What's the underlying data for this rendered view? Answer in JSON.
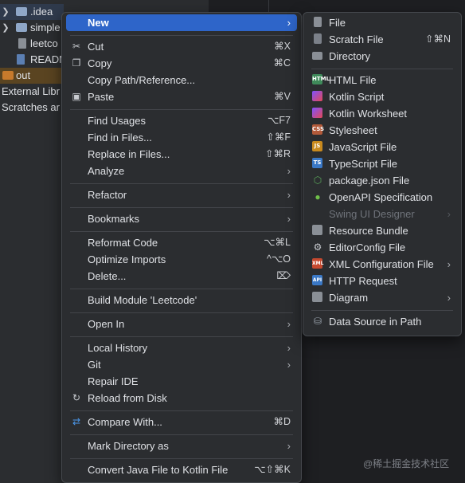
{
  "project_tree": {
    "items": [
      {
        "label": ".idea",
        "icon": "folder-icon"
      },
      {
        "label": "simple",
        "icon": "folder-icon"
      },
      {
        "label": "leetco",
        "icon": "file-icon"
      },
      {
        "label": "READM",
        "icon": "markdown-file-icon"
      },
      {
        "label": "out",
        "icon": "folder-icon"
      },
      {
        "label": "External Libr",
        "icon": ""
      },
      {
        "label": "Scratches ar",
        "icon": ""
      }
    ]
  },
  "context_menu": {
    "items": [
      {
        "label": "New",
        "shortcut": "",
        "arrow": "›",
        "icon": "",
        "highlighted": true
      },
      {
        "label": "Cut",
        "shortcut": "⌘X",
        "icon": "scissors-icon"
      },
      {
        "label": "Copy",
        "shortcut": "⌘C",
        "icon": "copy-icon"
      },
      {
        "label": "Copy Path/Reference...",
        "shortcut": ""
      },
      {
        "label": "Paste",
        "shortcut": "⌘V",
        "icon": "paste-icon"
      },
      {
        "label": "Find Usages",
        "shortcut": "⌥F7"
      },
      {
        "label": "Find in Files...",
        "shortcut": "⇧⌘F"
      },
      {
        "label": "Replace in Files...",
        "shortcut": "⇧⌘R"
      },
      {
        "label": "Analyze",
        "arrow": "›"
      },
      {
        "label": "Refactor",
        "arrow": "›"
      },
      {
        "label": "Bookmarks",
        "arrow": "›"
      },
      {
        "label": "Reformat Code",
        "shortcut": "⌥⌘L"
      },
      {
        "label": "Optimize Imports",
        "shortcut": "^⌥O"
      },
      {
        "label": "Delete...",
        "shortcut": "⌦"
      },
      {
        "label": "Build Module 'Leetcode'",
        "shortcut": ""
      },
      {
        "label": "Open In",
        "arrow": "›"
      },
      {
        "label": "Local History",
        "arrow": "›"
      },
      {
        "label": "Git",
        "arrow": "›"
      },
      {
        "label": "Repair IDE",
        "shortcut": ""
      },
      {
        "label": "Reload from Disk",
        "icon": "reload-icon"
      },
      {
        "label": "Compare With...",
        "shortcut": "⌘D",
        "icon": "compare-icon"
      },
      {
        "label": "Mark Directory as",
        "arrow": "›"
      },
      {
        "label": "Convert Java File to Kotlin File",
        "shortcut": "⌥⇧⌘K"
      }
    ]
  },
  "new_submenu": {
    "items": [
      {
        "label": "File",
        "icon": "file-icon"
      },
      {
        "label": "Scratch File",
        "shortcut": "⇧⌘N",
        "icon": "scratch-file-icon"
      },
      {
        "label": "Directory",
        "icon": "folder-icon"
      },
      {
        "label": "HTML File",
        "icon": "html-file-icon",
        "badge": "HTML"
      },
      {
        "label": "Kotlin Script",
        "icon": "kotlin-script-icon"
      },
      {
        "label": "Kotlin Worksheet",
        "icon": "kotlin-worksheet-icon"
      },
      {
        "label": "Stylesheet",
        "icon": "css-file-icon",
        "badge": "CSS"
      },
      {
        "label": "JavaScript File",
        "icon": "javascript-file-icon",
        "badge": "JS"
      },
      {
        "label": "TypeScript File",
        "icon": "typescript-file-icon",
        "badge": "TS"
      },
      {
        "label": "package.json File",
        "icon": "nodejs-icon"
      },
      {
        "label": "OpenAPI Specification",
        "icon": "openapi-icon"
      },
      {
        "label": "Swing UI Designer",
        "arrow": "›",
        "disabled": true
      },
      {
        "label": "Resource Bundle",
        "icon": "resource-bundle-icon"
      },
      {
        "label": "EditorConfig File",
        "icon": "gear-icon"
      },
      {
        "label": "XML Configuration File",
        "arrow": "›",
        "icon": "xml-file-icon",
        "badge": "XML"
      },
      {
        "label": "HTTP Request",
        "icon": "http-request-icon",
        "badge": "API"
      },
      {
        "label": "Diagram",
        "arrow": "›",
        "icon": "diagram-icon"
      },
      {
        "label": "Data Source in Path",
        "icon": "database-icon"
      }
    ]
  },
  "watermark": "@稀土掘金技术社区",
  "colors": {
    "highlight": "#2e65c9",
    "menu_bg": "#2b2d30",
    "out_folder": "#c77a2c",
    "folder": "#8fa7c7"
  }
}
